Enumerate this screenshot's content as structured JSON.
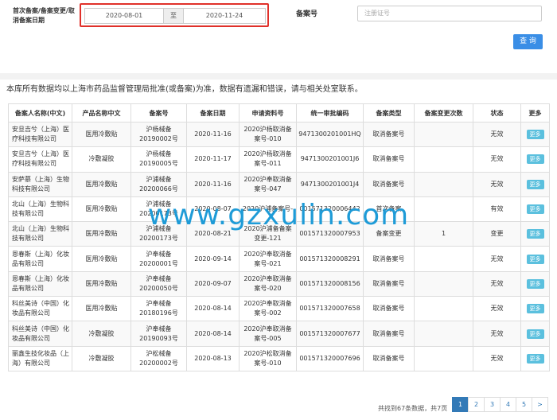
{
  "filter": {
    "date_label": "首次备案/备案变更/取消备案日期",
    "date_from": "2020-08-01",
    "date_sep": "至",
    "date_to": "2020-11-24",
    "no_label": "备案号",
    "no_placeholder": "注册证号",
    "search_label": "查 询"
  },
  "notice": "本库所有数据均以上海市药品监督管理局批准(或备案)为准，数据有遗漏和错误，请与相关处室联系。",
  "watermark": "www.gzxulin.com",
  "table": {
    "headers": [
      "备案人名称(中文)",
      "产品名称中文",
      "备案号",
      "备案日期",
      "申请资料号",
      "统一审批编码",
      "备案类型",
      "备案变更次数",
      "状态",
      "更多"
    ],
    "rows": [
      [
        "安旦吉兮（上海）医疗科技有限公司",
        "医用冷敷贴",
        "沪杨械备20190002号",
        "2020-11-16",
        "2020沪杨取消备案号-010",
        "9471300201001HQ",
        "取消备案号",
        "",
        "无效",
        "更多"
      ],
      [
        "安旦吉兮（上海）医疗科技有限公司",
        "冷敷凝胶",
        "沪杨械备20190005号",
        "2020-11-17",
        "2020沪杨取消备案号-011",
        "9471300201001J6",
        "取消备案号",
        "",
        "无效",
        "更多"
      ],
      [
        "安萨慕（上海）生物科技有限公司",
        "医用冷敷贴",
        "沪浦械备20200066号",
        "2020-11-16",
        "2020沪奉取消备案号-047",
        "9471300201001J4",
        "取消备案号",
        "",
        "无效",
        "更多"
      ],
      [
        "北山（上海）生物科技有限公司",
        "医用冷敷贴",
        "沪浦械备20200173号",
        "2020-08-07",
        "2020沪浦备案号-",
        "001571320006442",
        "首次备案",
        "",
        "有效",
        "更多"
      ],
      [
        "北山（上海）生物科技有限公司",
        "医用冷敷贴",
        "沪浦械备20200173号",
        "2020-08-21",
        "2020沪浦备备案变更-121",
        "001571320007953",
        "备案变更",
        "1",
        "变更",
        "更多"
      ],
      [
        "恩春斯（上海）化妆品有限公司",
        "医用冷敷贴",
        "沪奉械备20200001号",
        "2020-09-14",
        "2020沪奉取消备案号-021",
        "001571320008291",
        "取消备案号",
        "",
        "无效",
        "更多"
      ],
      [
        "恩春斯（上海）化妆品有限公司",
        "医用冷敷贴",
        "沪奉械备20200050号",
        "2020-09-07",
        "2020沪奉取消备案号-020",
        "001571320008156",
        "取消备案号",
        "",
        "无效",
        "更多"
      ],
      [
        "科丝美诗（中国）化妆品有限公司",
        "医用冷敷贴",
        "沪奉械备20180196号",
        "2020-08-14",
        "2020沪奉取消备案号-002",
        "001571320007658",
        "取消备案号",
        "",
        "无效",
        "更多"
      ],
      [
        "科丝美诗（中国）化妆品有限公司",
        "冷敷凝胶",
        "沪奉械备20190093号",
        "2020-08-14",
        "2020沪奉取消备案号-005",
        "001571320007677",
        "取消备案号",
        "",
        "无效",
        "更多"
      ],
      [
        "丽鑫生技化妆品（上海）有限公司",
        "冷敷凝胶",
        "沪松械备20200002号",
        "2020-08-13",
        "2020沪松取消备案号-010",
        "001571320007696",
        "取消备案号",
        "",
        "无效",
        "更多"
      ]
    ]
  },
  "footer": {
    "total_text": "共找到67条数据，共7页",
    "pages": [
      "1",
      "2",
      "3",
      "4",
      "5",
      ">"
    ]
  }
}
